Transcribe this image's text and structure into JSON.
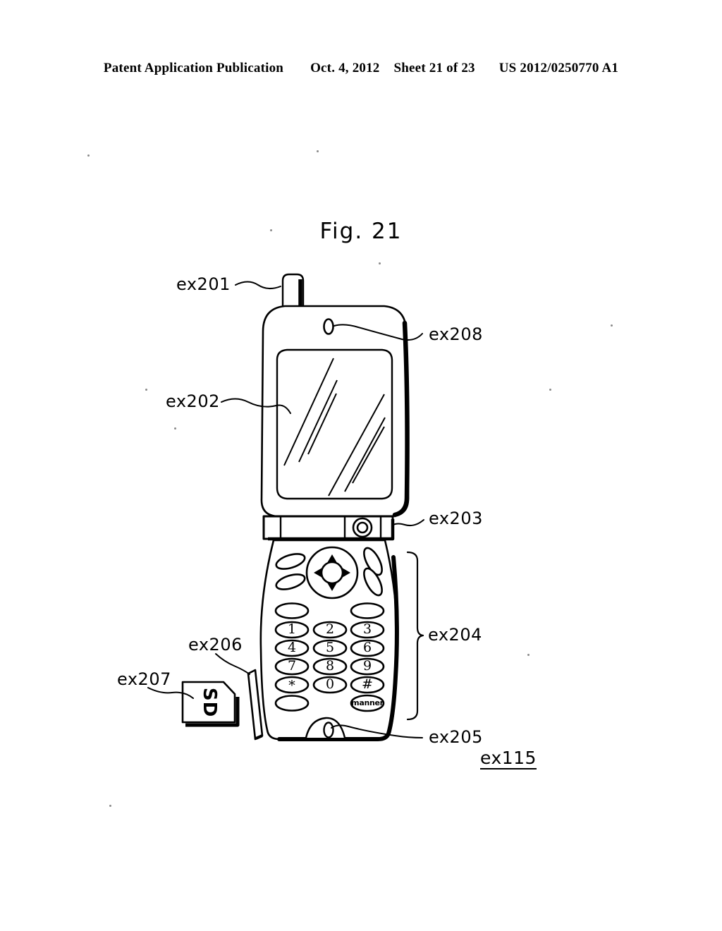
{
  "header": {
    "publication": "Patent Application Publication",
    "date": "Oct. 4, 2012",
    "sheet": "Sheet 21 of 23",
    "patent_number": "US 2012/0250770 A1"
  },
  "figure": {
    "title": "Fig. 21",
    "device_label": "ex115"
  },
  "labels": {
    "antenna": "ex201",
    "display": "ex202",
    "hinge": "ex203",
    "operation_keys": "ex204",
    "audio_input": "ex205",
    "slot": "ex206",
    "memory_card": "ex207",
    "camera": "ex208"
  },
  "memory_card": {
    "text": "SD"
  },
  "keypad": {
    "dpad": {
      "up": "▲",
      "down": "▼",
      "left": "◀",
      "right": "▶"
    },
    "rows": [
      [
        "",
        "",
        ""
      ],
      [
        "1",
        "2",
        "3"
      ],
      [
        "4",
        "5",
        "6"
      ],
      [
        "7",
        "8",
        "9"
      ],
      [
        "*",
        "0",
        "#"
      ],
      [
        "",
        "",
        "manner"
      ]
    ],
    "manner_key": "manner"
  },
  "colors": {
    "ink": "#000000",
    "paper": "#ffffff"
  }
}
